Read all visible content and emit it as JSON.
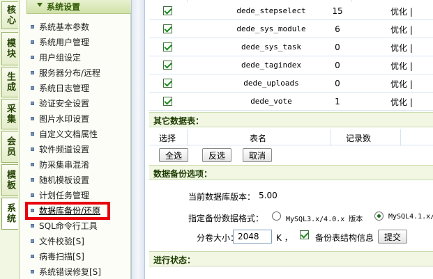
{
  "side_tabs": [
    {
      "label": "核心",
      "active": false
    },
    {
      "label": "模块",
      "active": false
    },
    {
      "label": "生成",
      "active": false
    },
    {
      "label": "采集",
      "active": false
    },
    {
      "label": "会员",
      "active": false
    },
    {
      "label": "模板",
      "active": false
    },
    {
      "label": "系统",
      "active": true
    }
  ],
  "menu": {
    "header": "系统设置",
    "items": [
      "系统基本参数",
      "系统用户管理",
      "用户组设定",
      "服务器分布/远程",
      "系统日志管理",
      "验证安全设置",
      "图片水印设置",
      "自定义文档属性",
      "软件频道设置",
      "防采集串混淆",
      "随机模板设置",
      "计划任务管理",
      "数据库备份/还原",
      "SQL命令行工具",
      "文件校验[S]",
      "病毒扫描[S]",
      "系统错误修复[S]"
    ],
    "selected_index": 12
  },
  "tables": [
    {
      "name": "dede_stepselect",
      "count": "15",
      "action": "优化 |"
    },
    {
      "name": "dede_sys_module",
      "count": "6",
      "action": "优化 |"
    },
    {
      "name": "dede_sys_task",
      "count": "0",
      "action": "优化 |"
    },
    {
      "name": "dede_tagindex",
      "count": "0",
      "action": "优化 |"
    },
    {
      "name": "dede_uploads",
      "count": "0",
      "action": "优化 |"
    },
    {
      "name": "dede_vote",
      "count": "1",
      "action": "优化 |"
    }
  ],
  "other_tables": {
    "title": "其它数据表：",
    "col_select": "选择",
    "col_name": "表名",
    "col_count": "记录数",
    "btn_select_all": "全选",
    "btn_invert": "反选",
    "btn_cancel": "取消"
  },
  "backup_options": {
    "title": "数据备份选项：",
    "db_version_label": "当前数据库版本：",
    "db_version": "5.00",
    "format_label": "指定备份数据格式：",
    "format_option_1": "MySQL3.x/4.0.x 版本",
    "format_option_2": "MySQL4.1.x/",
    "selected_format": 2,
    "volume_label": "分卷大小：",
    "volume_value": "2048",
    "volume_unit": "K ，",
    "structure_label": "备份表结构信息",
    "structure_checked": true,
    "submit_label": "提交"
  },
  "progress": {
    "title": "进行状态："
  }
}
